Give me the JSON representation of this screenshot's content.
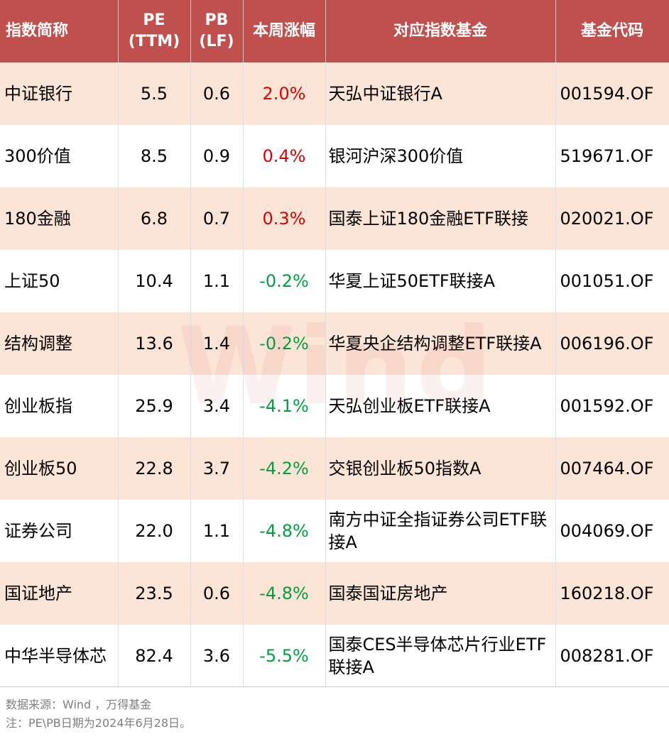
{
  "headers": {
    "name": "指数简称",
    "pe_line1": "PE",
    "pe_line2": "(TTM)",
    "pb_line1": "PB",
    "pb_line2": "(LF)",
    "weekly": "本周涨幅",
    "fund": "对应指数基金",
    "code": "基金代码"
  },
  "rows": [
    {
      "name": "中证银行",
      "pe": "5.5",
      "pb": "0.6",
      "weekly": "2.0%",
      "trend": "up",
      "fund": "天弘中证银行A",
      "code": "001594.OF"
    },
    {
      "name": "300价值",
      "pe": "8.5",
      "pb": "0.9",
      "weekly": "0.4%",
      "trend": "up",
      "fund": "银河沪深300价值",
      "code": "519671.OF"
    },
    {
      "name": "180金融",
      "pe": "6.8",
      "pb": "0.7",
      "weekly": "0.3%",
      "trend": "up",
      "fund": "国泰上证180金融ETF联接",
      "code": "020021.OF"
    },
    {
      "name": "上证50",
      "pe": "10.4",
      "pb": "1.1",
      "weekly": "-0.2%",
      "trend": "down",
      "fund": "华夏上证50ETF联接A",
      "code": "001051.OF"
    },
    {
      "name": "结构调整",
      "pe": "13.6",
      "pb": "1.4",
      "weekly": "-0.2%",
      "trend": "down",
      "fund": "华夏央企结构调整ETF联接A",
      "code": "006196.OF"
    },
    {
      "name": "创业板指",
      "pe": "25.9",
      "pb": "3.4",
      "weekly": "-4.1%",
      "trend": "down",
      "fund": "天弘创业板ETF联接A",
      "code": "001592.OF"
    },
    {
      "name": "创业板50",
      "pe": "22.8",
      "pb": "3.7",
      "weekly": "-4.2%",
      "trend": "down",
      "fund": "交银创业板50指数A",
      "code": "007464.OF"
    },
    {
      "name": "证券公司",
      "pe": "22.0",
      "pb": "1.1",
      "weekly": "-4.8%",
      "trend": "down",
      "fund": "南方中证全指证券公司ETF联接A",
      "code": "004069.OF"
    },
    {
      "name": "国证地产",
      "pe": "23.5",
      "pb": "0.6",
      "weekly": "-4.8%",
      "trend": "down",
      "fund": "国泰国证房地产",
      "code": "160218.OF"
    },
    {
      "name": "中华半导体芯",
      "pe": "82.4",
      "pb": "3.6",
      "weekly": "-5.5%",
      "trend": "down",
      "fund": "国泰CES半导体芯片行业ETF联接A",
      "code": "008281.OF"
    }
  ],
  "watermark": "Wind",
  "footer": {
    "source": "数据来源：Wind ，万得基金",
    "note": "注：PE\\PB日期为2024年6月28日。"
  },
  "colors": {
    "header_bg": "#c0504d",
    "odd_row_bg": "#fce4d6",
    "up": "#e00000",
    "down": "#00a040"
  }
}
